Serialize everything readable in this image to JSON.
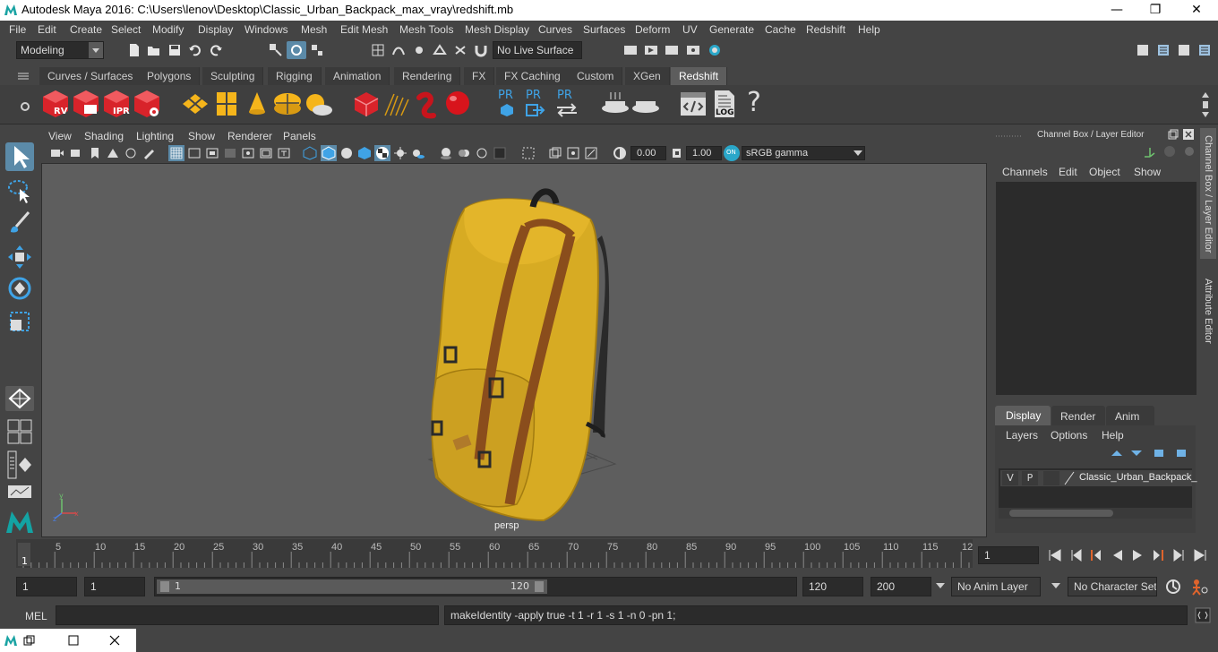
{
  "window": {
    "title": "Autodesk Maya 2016: C:\\Users\\lenov\\Desktop\\Classic_Urban_Backpack_max_vray\\redshift.mb",
    "minimize": "—",
    "maximize": "❐",
    "close": "✕"
  },
  "menus": [
    "File",
    "Edit",
    "Create",
    "Select",
    "Modify",
    "Display",
    "Windows",
    "Mesh",
    "Edit Mesh",
    "Mesh Tools",
    "Mesh Display",
    "Curves",
    "Surfaces",
    "Deform",
    "UV",
    "Generate",
    "Cache",
    "Redshift",
    "Help"
  ],
  "status": {
    "mode": "Modeling",
    "live_surface": "No Live Surface"
  },
  "shelf_tabs": [
    "Curves / Surfaces",
    "Polygons",
    "Sculpting",
    "Rigging",
    "Animation",
    "Rendering",
    "FX",
    "FX Caching",
    "Custom",
    "XGen",
    "Redshift"
  ],
  "shelf_active": "Redshift",
  "shelf_labels": {
    "rv": "RV",
    "ipr": "IPR",
    "pr1": "PR",
    "pr2": "PR",
    "pr3": "PR",
    "log": "LOG",
    "help": "?"
  },
  "viewport_menu": [
    "View",
    "Shading",
    "Lighting",
    "Show",
    "Renderer",
    "Panels"
  ],
  "viewport_fields": {
    "exposure": "0.00",
    "gamma": "1.00",
    "color_space": "sRGB gamma"
  },
  "camera_label": "persp",
  "channel_box": {
    "header": "Channel Box / Layer Editor",
    "menu": [
      "Channels",
      "Edit",
      "Object",
      "Show"
    ]
  },
  "layer_editor": {
    "tabs": [
      "Display",
      "Render",
      "Anim"
    ],
    "active_tab": "Display",
    "menu": [
      "Layers",
      "Options",
      "Help"
    ],
    "layer": {
      "v": "V",
      "p": "P",
      "name": "Classic_Urban_Backpack_"
    }
  },
  "side_tabs": [
    "Channel Box / Layer Editor",
    "Attribute Editor"
  ],
  "timeline": {
    "ticks": [
      "5",
      "10",
      "15",
      "20",
      "25",
      "30",
      "35",
      "40",
      "45",
      "50",
      "55",
      "60",
      "65",
      "70",
      "75",
      "80",
      "85",
      "90",
      "95",
      "100",
      "105",
      "110",
      "115",
      "12"
    ],
    "start_marker": "1",
    "current_frame": "1"
  },
  "range": {
    "start": "1",
    "playback_start": "1",
    "slider_start": "1",
    "slider_end": "120",
    "playback_end": "120",
    "end": "200",
    "anim_layer": "No Anim Layer",
    "character_set": "No Character Set"
  },
  "command": {
    "label": "MEL",
    "output": "makeIdentity -apply true -t 1 -r 1 -s 1 -n 0 -pn 1;"
  }
}
